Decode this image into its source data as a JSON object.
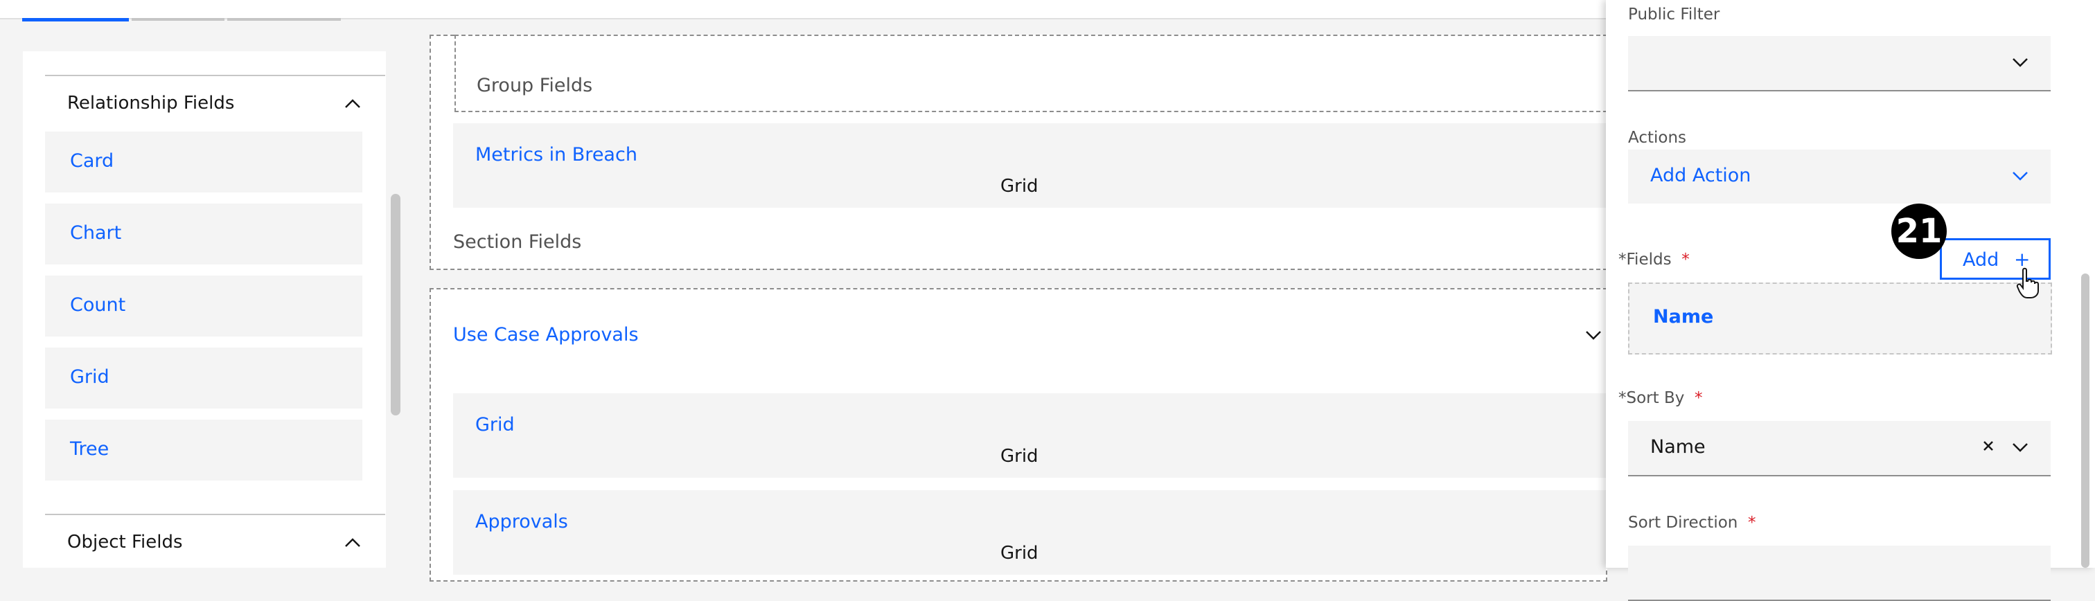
{
  "left_panel": {
    "relationship_fields": {
      "title": "Relationship Fields",
      "items": [
        "Card",
        "Chart",
        "Count",
        "Grid",
        "Tree"
      ]
    },
    "object_fields": {
      "title": "Object Fields"
    }
  },
  "canvas": {
    "group_fields_label": "Group Fields",
    "metrics_card": {
      "title": "Metrics in Breach",
      "type": "Grid"
    },
    "section_fields_label": "Section Fields",
    "use_case_section": {
      "title": "Use Case Approvals"
    },
    "grid_card": {
      "title": "Grid",
      "type": "Grid"
    },
    "approvals_card": {
      "title": "Approvals",
      "type": "Grid"
    }
  },
  "right_panel": {
    "public_filter": {
      "label": "Public Filter",
      "value": ""
    },
    "actions": {
      "label": "Actions",
      "value": "Add Action"
    },
    "fields": {
      "label": "Fields",
      "add_label": "Add",
      "add_icon": "+",
      "items": [
        "Name"
      ]
    },
    "sort_by": {
      "label": "Sort By",
      "value": "Name"
    },
    "sort_direction": {
      "label": "Sort Direction"
    },
    "required_marker": "*"
  },
  "badge": {
    "step": "21"
  },
  "colors": {
    "link": "#0f62fe",
    "required": "#da1e28"
  }
}
